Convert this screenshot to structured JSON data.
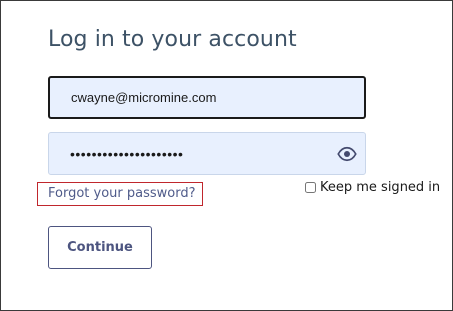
{
  "heading": "Log in to your account",
  "email": {
    "value": "cwayne@micromine.com"
  },
  "password": {
    "value": "•••••••••••••••••••••",
    "toggle_icon": "eye-icon"
  },
  "forgot_password": "Forgot your password?",
  "keep_signed_in": {
    "label": "Keep me signed in",
    "checked": false
  },
  "continue_label": "Continue",
  "colors": {
    "heading": "#3d5266",
    "field_bg": "#e8f0fe",
    "link": "#4f5b8a",
    "highlight_box": "#c0272d",
    "button": "#4d5580"
  }
}
